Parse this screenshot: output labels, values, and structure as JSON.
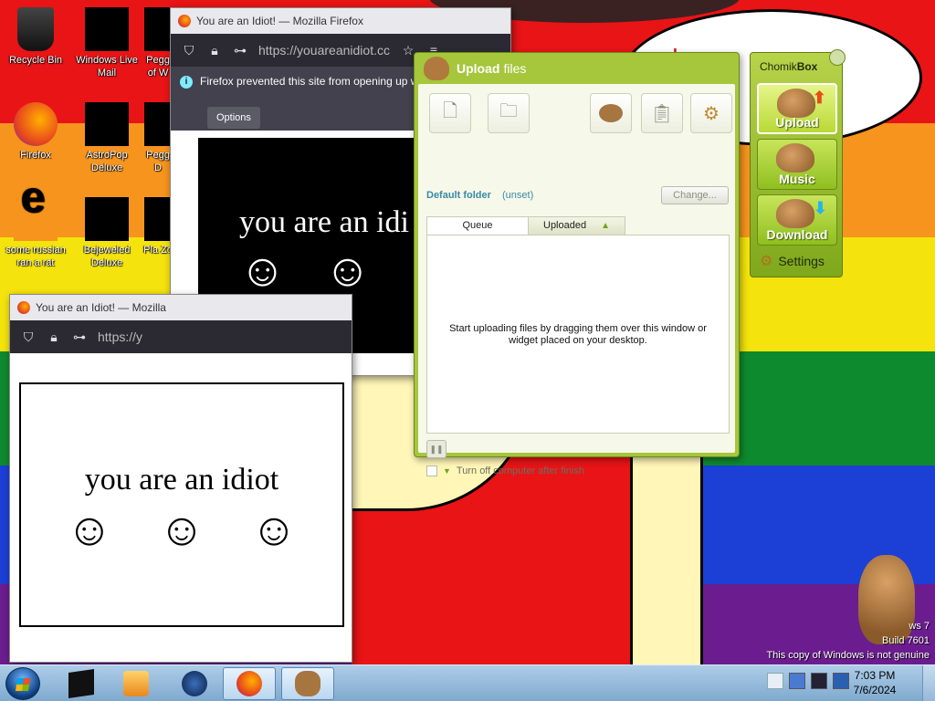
{
  "desktop": {
    "icons": [
      {
        "label": "Recycle Bin"
      },
      {
        "label": "Windows Live Mail"
      },
      {
        "label": "Pegg of W"
      },
      {
        "label": "Firefox"
      },
      {
        "label": "AstroPop Deluxe"
      },
      {
        "label": "Pegg D"
      },
      {
        "label": "some russian ran a rat"
      },
      {
        "label": "Bejeweled Deluxe"
      },
      {
        "label": "Pla Zo"
      }
    ],
    "wallpaper_speech_text": "... h",
    "watermark": {
      "line1": "ws 7",
      "line2": "Build 7601",
      "line3": "This copy of Windows is not genuine"
    }
  },
  "firefox_back": {
    "title": "You are an Idiot! — Mozilla Firefox",
    "url": "https://youareanidiot.cc",
    "notice": "Firefox prevented this site from opening up windows.",
    "options_label": "Options",
    "page_text": "you are an idi",
    "faces": [
      "☺",
      "☺",
      "☺"
    ]
  },
  "firefox_front": {
    "title": "You are an Idiot! — Mozilla",
    "url": "https://y",
    "page_text": "you are an idiot",
    "faces": [
      "☺",
      "☺",
      "☺"
    ]
  },
  "upload": {
    "title_bold": "Upload",
    "title_rest": "files",
    "default_folder_label": "Default folder",
    "default_folder_value": "(unset)",
    "change_label": "Change...",
    "tabs": [
      "Queue",
      "Uploaded"
    ],
    "queue_message": "Start uploading files by dragging them over this window or widget placed on your desktop.",
    "turn_off_label": "Turn off computer after finish"
  },
  "chomikbox": {
    "title_regular": "Chomik",
    "title_bold": "Box",
    "buttons": [
      "Upload",
      "Music",
      "Download"
    ],
    "settings_label": "Settings"
  },
  "taskbar": {
    "time": "7:03 PM",
    "date": "7/6/2024"
  }
}
